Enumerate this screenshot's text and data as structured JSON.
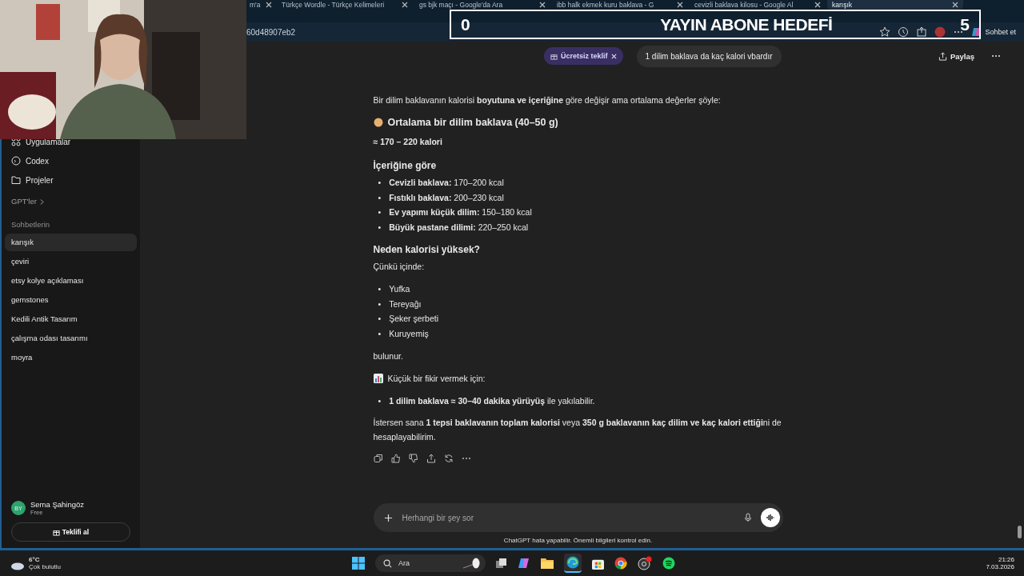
{
  "browser": {
    "tabs": [
      {
        "title": "m'a",
        "selected": false
      },
      {
        "title": "Türkçe Wordle - Türkçe Kelimeleri",
        "selected": false
      },
      {
        "title": "gs bjk maçı - Google'da Ara",
        "selected": false
      },
      {
        "title": "ibb halk ekmek kuru baklava - G",
        "selected": false
      },
      {
        "title": "cevizli baklava kilosu - Google Al",
        "selected": false
      },
      {
        "title": "karışık",
        "selected": true
      }
    ],
    "address": "60d48907eb2",
    "chat_button": "Sohbet et"
  },
  "stream_overlay": {
    "left_count": "0",
    "title": "YAYIN ABONE HEDEFİ",
    "right_count": "5"
  },
  "sidebar": {
    "nav": [
      {
        "label": "Uygulamalar"
      },
      {
        "label": "Codex"
      },
      {
        "label": "Projeler"
      }
    ],
    "gpts": "GPT'ler",
    "section": "Sohbetlerin",
    "chats": [
      {
        "title": "karışık",
        "selected": true
      },
      {
        "title": "çeviri",
        "selected": false
      },
      {
        "title": "etsy kolye açıklaması",
        "selected": false
      },
      {
        "title": "gemstones",
        "selected": false
      },
      {
        "title": "Kedili Antik Tasarım",
        "selected": false
      },
      {
        "title": "çalışma odası tasarımı",
        "selected": false
      },
      {
        "title": "moyra",
        "selected": false
      }
    ],
    "user": {
      "initials": "BY",
      "name": "Sema Şahingöz",
      "plan": "Free"
    },
    "offer_button": "Teklifi al"
  },
  "header": {
    "offer_badge": "Ücretsiz teklif",
    "user_message": "1 dilim baklava da kaç kalori vbardır",
    "share": "Paylaş"
  },
  "answer": [
    {
      "kind": "paragraph",
      "text": "Bir dilim baklavanın kalorisi **boyutuna ve içeriğine** göre değişir ama ortalama değerler şöyle:"
    },
    {
      "kind": "heading",
      "text": "Ortalama bir dilim baklava (40–50 g)"
    },
    {
      "kind": "strong",
      "text": "≈ 170 – 220 kalori"
    },
    {
      "kind": "subheading",
      "text": "İçeriğine göre"
    },
    {
      "kind": "list",
      "bullet": "•",
      "items": [
        "**Cevizli baklava:** 170–200 kcal",
        "**Fıstıklı baklava:** 200–230 kcal",
        "**Ev yapımı küçük dilim:** 150–180 kcal",
        "**Büyük pastane dilimi:** 220–250 kcal"
      ]
    },
    {
      "kind": "subheading",
      "text": "Neden kalorisi yüksek?"
    },
    {
      "kind": "paragraph",
      "text": "Çünkü içinde:"
    },
    {
      "kind": "list",
      "bullet": "•",
      "items": [
        "Yufka",
        "Tereyağı",
        "Şeker şerbeti",
        "Kuruyemiş"
      ]
    },
    {
      "kind": "paragraph",
      "text": "bulunur."
    },
    {
      "kind": "note",
      "text": "Küçük bir fikir vermek için:"
    },
    {
      "kind": "list",
      "bullet": "•",
      "items": [
        "**1 dilim baklava ≈ 30–40 dakika yürüyüş** ile yakılabilir."
      ]
    },
    {
      "kind": "paragraph",
      "text": "İstersen sana **1 tepsi baklavanın toplam kalorisi** veya **350 g baklavanın kaç dilim ve kaç kalori ettiği**ni de hesaplayabilirim."
    }
  ],
  "composer": {
    "placeholder": "Herhangi bir şey sor"
  },
  "disclaimer": "ChatGPT hata yapabilir. Önemli bilgileri kontrol edin.",
  "taskbar": {
    "temperature": "6°C",
    "weather": "Çok bulutlu",
    "search_placeholder": "Ara",
    "time": "21:26",
    "date": "7.03.2026"
  }
}
